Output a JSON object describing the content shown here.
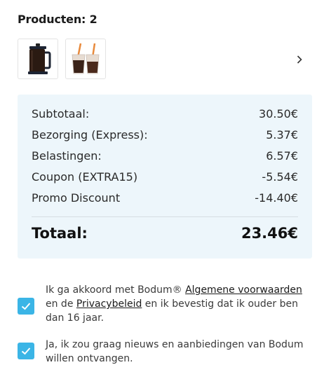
{
  "products": {
    "header": "Producten: 2",
    "items": [
      {
        "icon": "french-press-icon"
      },
      {
        "icon": "iced-coffee-glasses-icon"
      }
    ],
    "next_icon": "chevron-right-icon"
  },
  "summary": {
    "rows": [
      {
        "label": "Subtotaal:",
        "value": "30.50€"
      },
      {
        "label": "Bezorging (Express):",
        "value": "5.37€"
      },
      {
        "label": "Belastingen:",
        "value": "6.57€"
      },
      {
        "label": "Coupon (EXTRA15)",
        "value": "-5.54€"
      },
      {
        "label": "Promo Discount",
        "value": "-14.40€"
      }
    ],
    "total_label": "Totaal:",
    "total_value": "23.46€",
    "background_color": "#edf6fb"
  },
  "consents": {
    "terms": {
      "checked": true,
      "text_before": "Ik ga akkoord met Bodum® ",
      "link1": "Algemene voorwaarden",
      "text_middle": " en de ",
      "link2": "Privacybeleid",
      "text_after": " en ik bevestig dat ik ouder ben dan 16 jaar."
    },
    "newsletter": {
      "checked": true,
      "text": "Ja, ik zou graag nieuws en aanbiedingen van Bodum willen ontvangen."
    },
    "checkbox_color": "#3bb5e6"
  }
}
